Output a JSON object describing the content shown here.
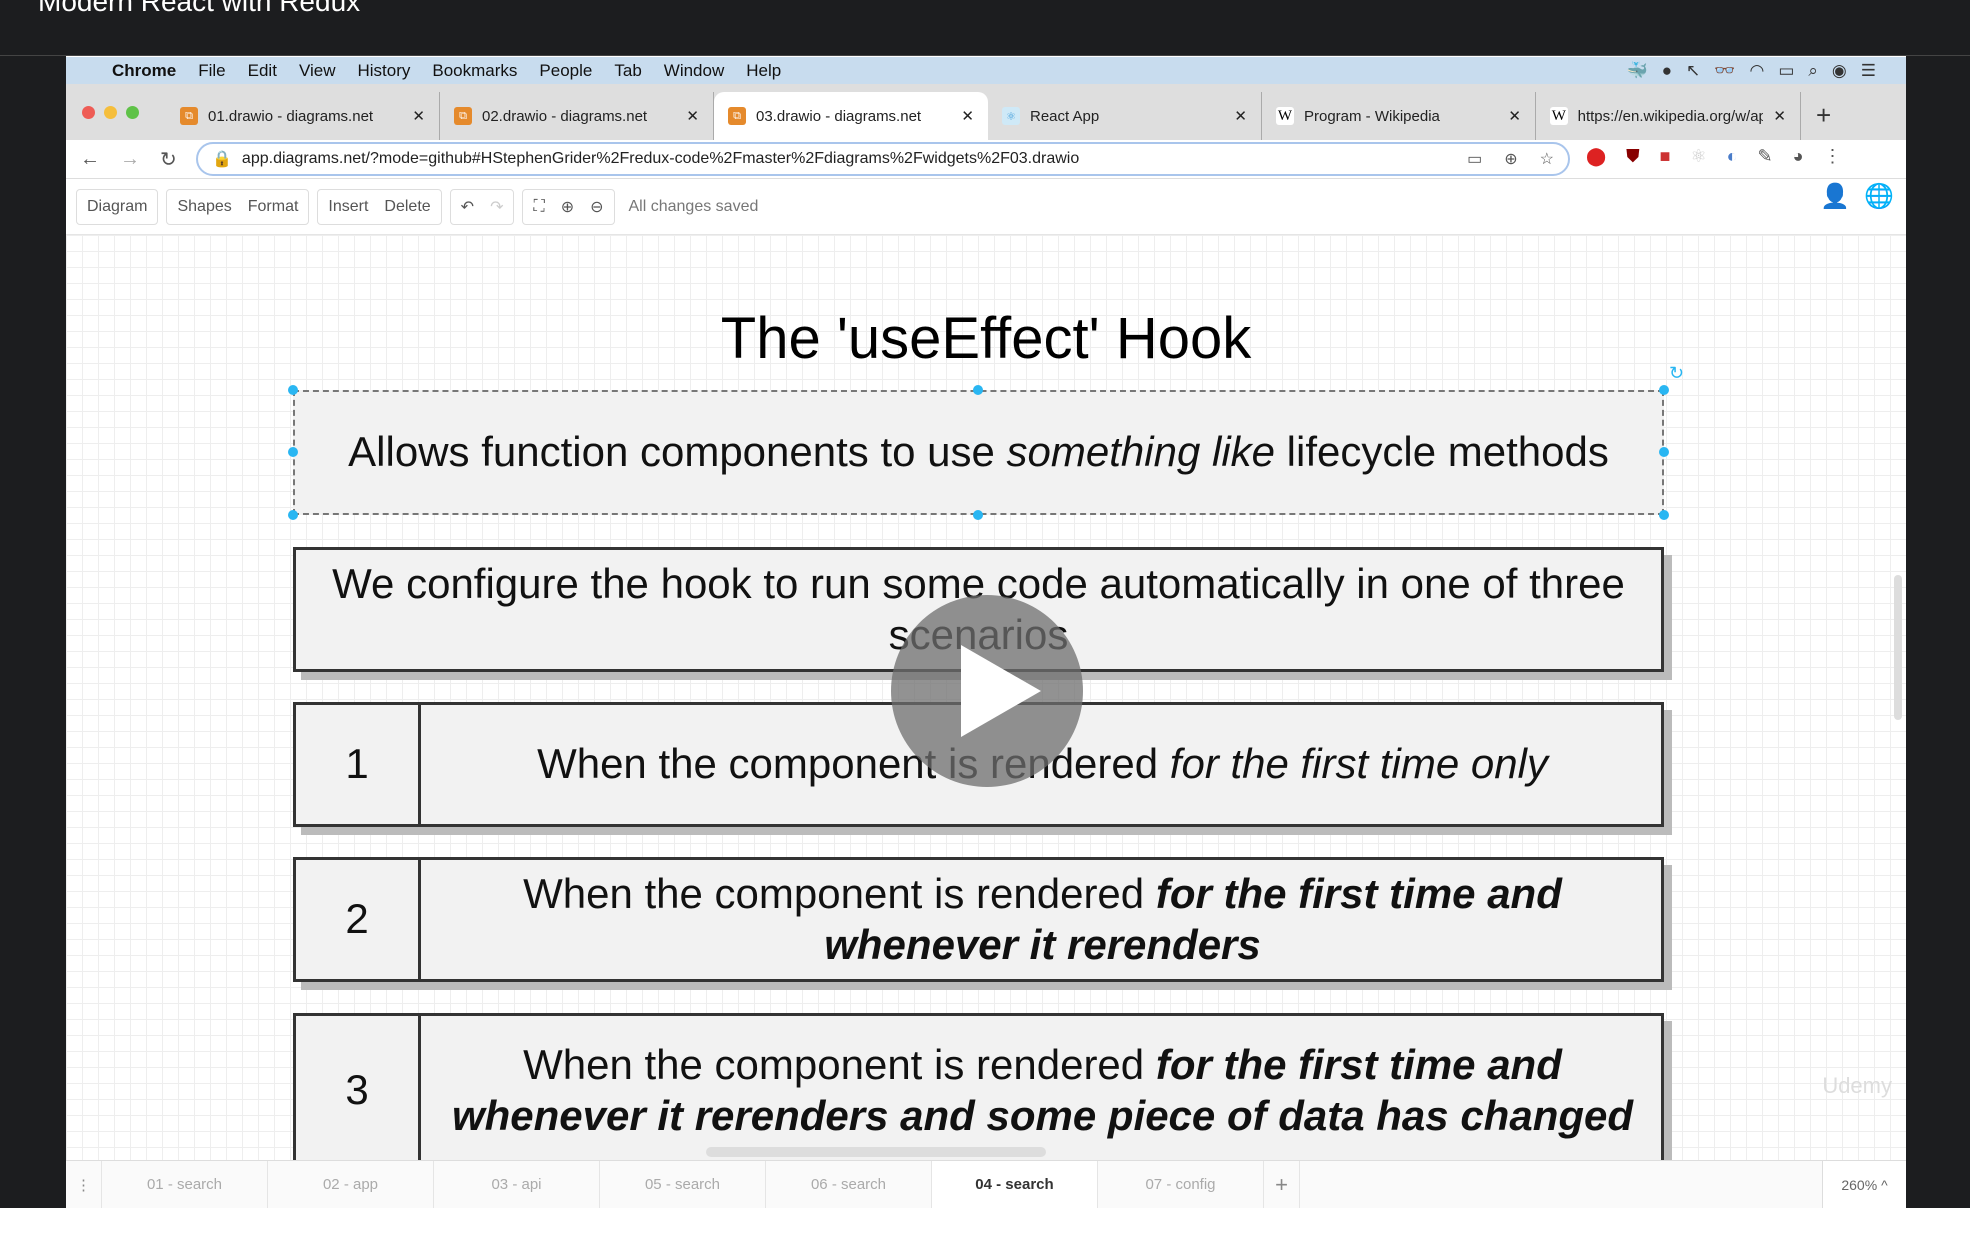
{
  "course_title": "Modern React with Redux",
  "menubar": {
    "app": "Chrome",
    "items": [
      "File",
      "Edit",
      "View",
      "History",
      "Bookmarks",
      "People",
      "Tab",
      "Window",
      "Help"
    ]
  },
  "tabs": [
    {
      "title": "01.drawio - diagrams.net",
      "icon": "drawio-icon"
    },
    {
      "title": "02.drawio - diagrams.net",
      "icon": "drawio-icon"
    },
    {
      "title": "03.drawio - diagrams.net",
      "icon": "drawio-icon",
      "active": true
    },
    {
      "title": "React App",
      "icon": "react-icon"
    },
    {
      "title": "Program - Wikipedia",
      "icon": "wikipedia-icon"
    },
    {
      "title": "https://en.wikipedia.org/w/ap",
      "icon": "wikipedia-icon"
    }
  ],
  "url": "app.diagrams.net/?mode=github#HStephenGrider%2Fredux-code%2Fmaster%2Fdiagrams%2Fwidgets%2F03.drawio",
  "toolbar": {
    "diagram": "Diagram",
    "shapes": "Shapes",
    "format": "Format",
    "insert": "Insert",
    "delete": "Delete",
    "status": "All changes saved"
  },
  "diagram": {
    "title": "The 'useEffect' Hook",
    "intro": {
      "pre": "Allows function components to use ",
      "em": "something like",
      "post": " lifecycle methods"
    },
    "config": "We configure the hook to run some code automatically in one of three scenarios",
    "scenarios": [
      {
        "num": "1",
        "pre": "When the component is rendered ",
        "em": "for the first time only"
      },
      {
        "num": "2",
        "pre": "When the component is rendered ",
        "em": "for the first time and whenever it rerenders"
      },
      {
        "num": "3",
        "pre": "When the component is rendered ",
        "em": "for the first time and whenever it rerenders and some piece of data has changed"
      }
    ]
  },
  "watermark": "Udemy",
  "pages": [
    "01 - search",
    "02 - app",
    "03 - api",
    "05 - search",
    "06 - search",
    "04 - search",
    "07 - config"
  ],
  "active_page": "04 - search",
  "zoom": "260%"
}
